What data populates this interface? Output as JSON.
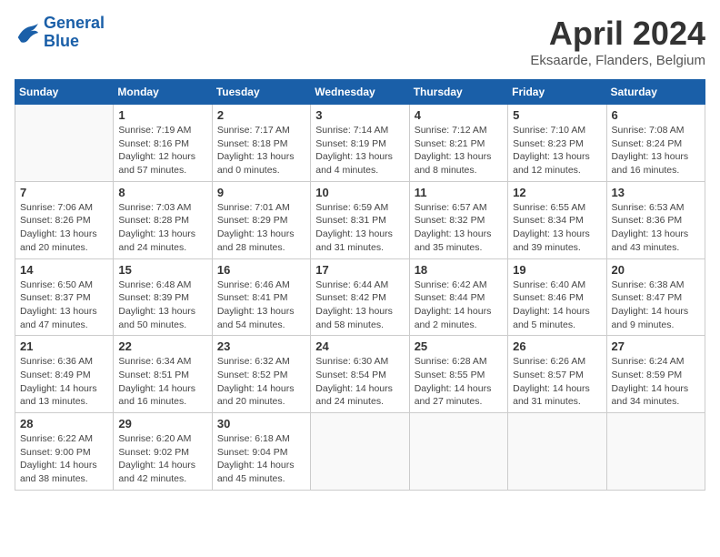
{
  "logo": {
    "line1": "General",
    "line2": "Blue"
  },
  "title": "April 2024",
  "location": "Eksaarde, Flanders, Belgium",
  "weekdays": [
    "Sunday",
    "Monday",
    "Tuesday",
    "Wednesday",
    "Thursday",
    "Friday",
    "Saturday"
  ],
  "weeks": [
    [
      {
        "day": "",
        "info": ""
      },
      {
        "day": "1",
        "info": "Sunrise: 7:19 AM\nSunset: 8:16 PM\nDaylight: 12 hours\nand 57 minutes."
      },
      {
        "day": "2",
        "info": "Sunrise: 7:17 AM\nSunset: 8:18 PM\nDaylight: 13 hours\nand 0 minutes."
      },
      {
        "day": "3",
        "info": "Sunrise: 7:14 AM\nSunset: 8:19 PM\nDaylight: 13 hours\nand 4 minutes."
      },
      {
        "day": "4",
        "info": "Sunrise: 7:12 AM\nSunset: 8:21 PM\nDaylight: 13 hours\nand 8 minutes."
      },
      {
        "day": "5",
        "info": "Sunrise: 7:10 AM\nSunset: 8:23 PM\nDaylight: 13 hours\nand 12 minutes."
      },
      {
        "day": "6",
        "info": "Sunrise: 7:08 AM\nSunset: 8:24 PM\nDaylight: 13 hours\nand 16 minutes."
      }
    ],
    [
      {
        "day": "7",
        "info": "Sunrise: 7:06 AM\nSunset: 8:26 PM\nDaylight: 13 hours\nand 20 minutes."
      },
      {
        "day": "8",
        "info": "Sunrise: 7:03 AM\nSunset: 8:28 PM\nDaylight: 13 hours\nand 24 minutes."
      },
      {
        "day": "9",
        "info": "Sunrise: 7:01 AM\nSunset: 8:29 PM\nDaylight: 13 hours\nand 28 minutes."
      },
      {
        "day": "10",
        "info": "Sunrise: 6:59 AM\nSunset: 8:31 PM\nDaylight: 13 hours\nand 31 minutes."
      },
      {
        "day": "11",
        "info": "Sunrise: 6:57 AM\nSunset: 8:32 PM\nDaylight: 13 hours\nand 35 minutes."
      },
      {
        "day": "12",
        "info": "Sunrise: 6:55 AM\nSunset: 8:34 PM\nDaylight: 13 hours\nand 39 minutes."
      },
      {
        "day": "13",
        "info": "Sunrise: 6:53 AM\nSunset: 8:36 PM\nDaylight: 13 hours\nand 43 minutes."
      }
    ],
    [
      {
        "day": "14",
        "info": "Sunrise: 6:50 AM\nSunset: 8:37 PM\nDaylight: 13 hours\nand 47 minutes."
      },
      {
        "day": "15",
        "info": "Sunrise: 6:48 AM\nSunset: 8:39 PM\nDaylight: 13 hours\nand 50 minutes."
      },
      {
        "day": "16",
        "info": "Sunrise: 6:46 AM\nSunset: 8:41 PM\nDaylight: 13 hours\nand 54 minutes."
      },
      {
        "day": "17",
        "info": "Sunrise: 6:44 AM\nSunset: 8:42 PM\nDaylight: 13 hours\nand 58 minutes."
      },
      {
        "day": "18",
        "info": "Sunrise: 6:42 AM\nSunset: 8:44 PM\nDaylight: 14 hours\nand 2 minutes."
      },
      {
        "day": "19",
        "info": "Sunrise: 6:40 AM\nSunset: 8:46 PM\nDaylight: 14 hours\nand 5 minutes."
      },
      {
        "day": "20",
        "info": "Sunrise: 6:38 AM\nSunset: 8:47 PM\nDaylight: 14 hours\nand 9 minutes."
      }
    ],
    [
      {
        "day": "21",
        "info": "Sunrise: 6:36 AM\nSunset: 8:49 PM\nDaylight: 14 hours\nand 13 minutes."
      },
      {
        "day": "22",
        "info": "Sunrise: 6:34 AM\nSunset: 8:51 PM\nDaylight: 14 hours\nand 16 minutes."
      },
      {
        "day": "23",
        "info": "Sunrise: 6:32 AM\nSunset: 8:52 PM\nDaylight: 14 hours\nand 20 minutes."
      },
      {
        "day": "24",
        "info": "Sunrise: 6:30 AM\nSunset: 8:54 PM\nDaylight: 14 hours\nand 24 minutes."
      },
      {
        "day": "25",
        "info": "Sunrise: 6:28 AM\nSunset: 8:55 PM\nDaylight: 14 hours\nand 27 minutes."
      },
      {
        "day": "26",
        "info": "Sunrise: 6:26 AM\nSunset: 8:57 PM\nDaylight: 14 hours\nand 31 minutes."
      },
      {
        "day": "27",
        "info": "Sunrise: 6:24 AM\nSunset: 8:59 PM\nDaylight: 14 hours\nand 34 minutes."
      }
    ],
    [
      {
        "day": "28",
        "info": "Sunrise: 6:22 AM\nSunset: 9:00 PM\nDaylight: 14 hours\nand 38 minutes."
      },
      {
        "day": "29",
        "info": "Sunrise: 6:20 AM\nSunset: 9:02 PM\nDaylight: 14 hours\nand 42 minutes."
      },
      {
        "day": "30",
        "info": "Sunrise: 6:18 AM\nSunset: 9:04 PM\nDaylight: 14 hours\nand 45 minutes."
      },
      {
        "day": "",
        "info": ""
      },
      {
        "day": "",
        "info": ""
      },
      {
        "day": "",
        "info": ""
      },
      {
        "day": "",
        "info": ""
      }
    ]
  ]
}
